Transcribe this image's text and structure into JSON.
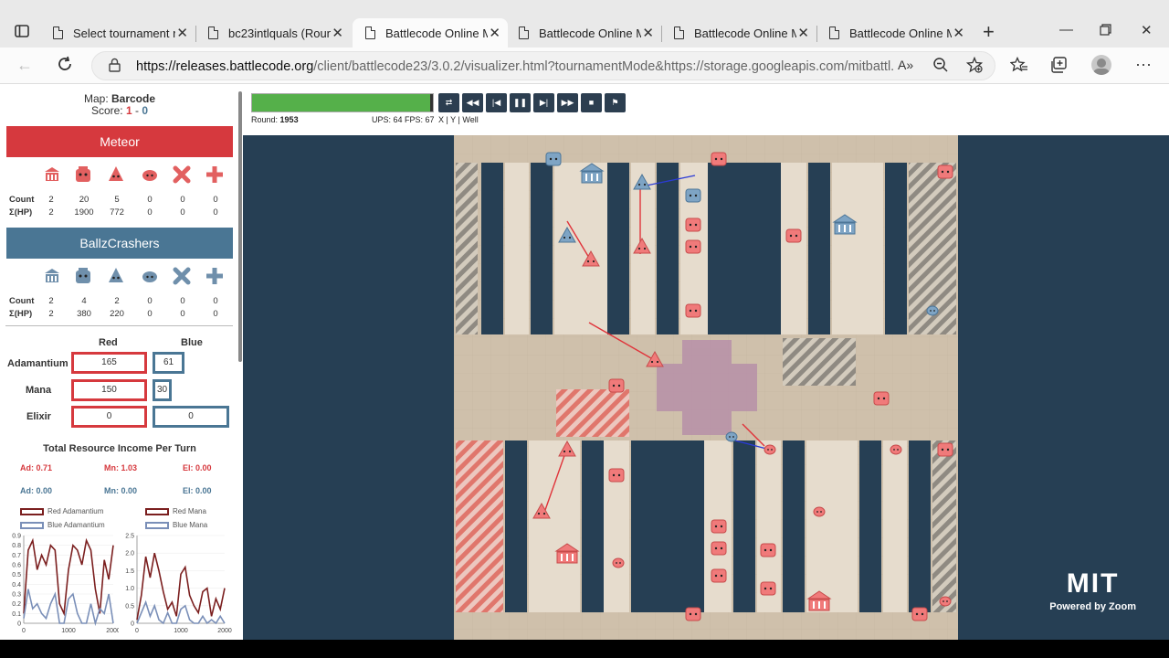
{
  "browser": {
    "tabs": [
      {
        "title": "Select tournament r",
        "active": false
      },
      {
        "title": "bc23intlquals (Roun",
        "active": false
      },
      {
        "title": "Battlecode Online M",
        "active": true
      },
      {
        "title": "Battlecode Online M",
        "active": false
      },
      {
        "title": "Battlecode Online M",
        "active": false
      },
      {
        "title": "Battlecode Online M",
        "active": false
      }
    ],
    "url_host": "https://releases.battlecode.org",
    "url_path": "/client/battlecode23/3.0.2/visualizer.html?tournamentMode&https://storage.googleapis.com/mitbattl..."
  },
  "sidebar": {
    "map_label": "Map:",
    "map_name": "Barcode",
    "score_label": "Score:",
    "score_red": "1",
    "score_sep": " - ",
    "score_blue": "0",
    "count_label": "Count",
    "hp_label": "Σ(HP)",
    "teams": [
      {
        "name": "Meteor",
        "color": "#d6393e",
        "counts": [
          "2",
          "20",
          "5",
          "0",
          "0",
          "0"
        ],
        "hp": [
          "2",
          "1900",
          "772",
          "0",
          "0",
          "0"
        ]
      },
      {
        "name": "BallzCrashers",
        "color": "#4a7694",
        "counts": [
          "2",
          "4",
          "2",
          "0",
          "0",
          "0"
        ],
        "hp": [
          "2",
          "380",
          "220",
          "0",
          "0",
          "0"
        ]
      }
    ],
    "unit_icons": [
      "headquarters-icon",
      "carrier-icon",
      "launcher-icon",
      "amplifier-icon",
      "destabilizer-icon",
      "booster-icon"
    ],
    "resources": {
      "red_header": "Red",
      "blue_header": "Blue",
      "rows": [
        {
          "label": "Adamantium",
          "red": "165",
          "blue": "61"
        },
        {
          "label": "Mana",
          "red": "150",
          "blue": "30"
        },
        {
          "label": "Elixir",
          "red": "0",
          "blue": "0"
        }
      ]
    },
    "income": {
      "title": "Total Resource Income Per Turn",
      "red": [
        "Ad: 0.71",
        "Mn: 1.03",
        "El: 0.00"
      ],
      "blue": [
        "Ad: 0.00",
        "Mn: 0.00",
        "El: 0.00"
      ]
    },
    "chart_legends": {
      "left": [
        "Red Adamantium",
        "Blue Adamantium"
      ],
      "right": [
        "Red Mana",
        "Blue Mana"
      ]
    }
  },
  "controls": {
    "progress": 0.99,
    "round_label": "Round:",
    "round": "1953",
    "ups_fps": "UPS: 64 FPS: 67",
    "toggles": "X | Y | Well",
    "buttons": [
      "swap",
      "rewind",
      "step-back",
      "pause",
      "step-forward",
      "fast-forward",
      "stop",
      "flag"
    ]
  },
  "watermark": {
    "logo": "MIT",
    "text": "Powered by Zoom"
  },
  "chart_data": [
    {
      "type": "line",
      "title": "",
      "x_ticks": [
        "0",
        "1000",
        "2000"
      ],
      "y_ticks": [
        "0",
        "0.1",
        "0.2",
        "0.3",
        "0.4",
        "0.5",
        "0.6",
        "0.7",
        "0.8",
        "0.9"
      ],
      "ylim": [
        0,
        0.9
      ],
      "xlim": [
        0,
        2000
      ],
      "series": [
        {
          "name": "Red Adamantium",
          "color": "#7b1f1f",
          "x": [
            0,
            100,
            200,
            300,
            400,
            500,
            600,
            700,
            800,
            900,
            1000,
            1100,
            1200,
            1300,
            1400,
            1500,
            1600,
            1700,
            1800,
            1900,
            2000
          ],
          "y": [
            0.1,
            0.75,
            0.85,
            0.55,
            0.7,
            0.6,
            0.8,
            0.75,
            0.2,
            0.1,
            0.55,
            0.8,
            0.75,
            0.6,
            0.85,
            0.75,
            0.35,
            0.1,
            0.65,
            0.45,
            0.8
          ]
        },
        {
          "name": "Blue Adamantium",
          "color": "#7a8fb8",
          "x": [
            0,
            100,
            200,
            300,
            400,
            500,
            600,
            700,
            800,
            900,
            1000,
            1100,
            1200,
            1300,
            1400,
            1500,
            1600,
            1700,
            1800,
            1900,
            2000
          ],
          "y": [
            0.05,
            0.35,
            0.15,
            0.2,
            0.1,
            0.05,
            0.2,
            0.3,
            0.0,
            0.0,
            0.25,
            0.3,
            0.1,
            0.0,
            0.0,
            0.2,
            0.0,
            0.15,
            0.1,
            0.3,
            0.0
          ]
        }
      ]
    },
    {
      "type": "line",
      "title": "",
      "x_ticks": [
        "0",
        "1000",
        "2000"
      ],
      "y_ticks": [
        "0",
        "0.5",
        "1.0",
        "1.5",
        "2.0",
        "2.5"
      ],
      "ylim": [
        0,
        2.5
      ],
      "xlim": [
        0,
        2000
      ],
      "series": [
        {
          "name": "Red Mana",
          "color": "#7b1f1f",
          "x": [
            0,
            100,
            200,
            300,
            400,
            500,
            600,
            700,
            800,
            900,
            1000,
            1100,
            1200,
            1300,
            1400,
            1500,
            1600,
            1700,
            1800,
            1900,
            2000
          ],
          "y": [
            0.1,
            0.8,
            1.9,
            1.3,
            2.0,
            1.5,
            0.9,
            0.4,
            0.6,
            0.2,
            1.4,
            1.6,
            0.8,
            0.5,
            0.3,
            0.9,
            1.0,
            0.2,
            0.7,
            0.4,
            1.0
          ]
        },
        {
          "name": "Blue Mana",
          "color": "#7a8fb8",
          "x": [
            0,
            100,
            200,
            300,
            400,
            500,
            600,
            700,
            800,
            900,
            1000,
            1100,
            1200,
            1300,
            1400,
            1500,
            1600,
            1700,
            1800,
            1900,
            2000
          ],
          "y": [
            0.0,
            0.3,
            0.6,
            0.2,
            0.5,
            0.1,
            0.0,
            0.3,
            0.0,
            0.0,
            0.4,
            0.5,
            0.1,
            0.0,
            0.0,
            0.2,
            0.0,
            0.1,
            0.0,
            0.2,
            0.0
          ]
        }
      ]
    }
  ]
}
